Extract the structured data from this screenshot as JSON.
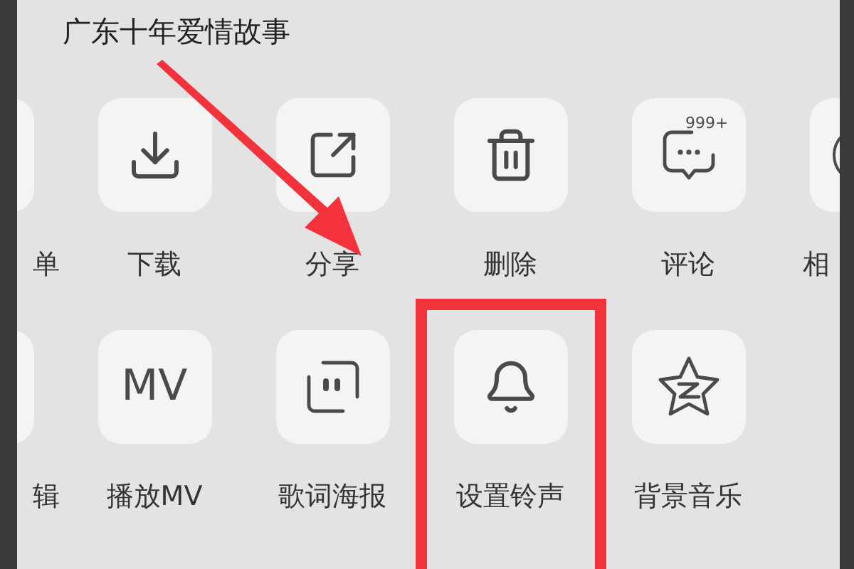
{
  "title": "广东十年爱情故事",
  "rows": [
    {
      "items": [
        {
          "kind": "clipped-left",
          "label": "单",
          "highlighted": false
        },
        {
          "kind": "download",
          "label": "下载",
          "highlighted": false
        },
        {
          "kind": "share",
          "label": "分享",
          "highlighted": false
        },
        {
          "kind": "delete",
          "label": "删除",
          "highlighted": false
        },
        {
          "kind": "comment",
          "label": "评论",
          "badge": "999+",
          "highlighted": false
        },
        {
          "kind": "clipped-right",
          "label": "相",
          "highlighted": false
        }
      ]
    },
    {
      "items": [
        {
          "kind": "clipped-left",
          "label": "辑",
          "highlighted": false
        },
        {
          "kind": "text",
          "label": "播放MV",
          "icon_text": "MV",
          "highlighted": false
        },
        {
          "kind": "poster",
          "label": "歌词海报",
          "highlighted": false
        },
        {
          "kind": "bell",
          "label": "设置铃声",
          "highlighted": true
        },
        {
          "kind": "star",
          "label": "背景音乐",
          "highlighted": false
        }
      ]
    }
  ]
}
